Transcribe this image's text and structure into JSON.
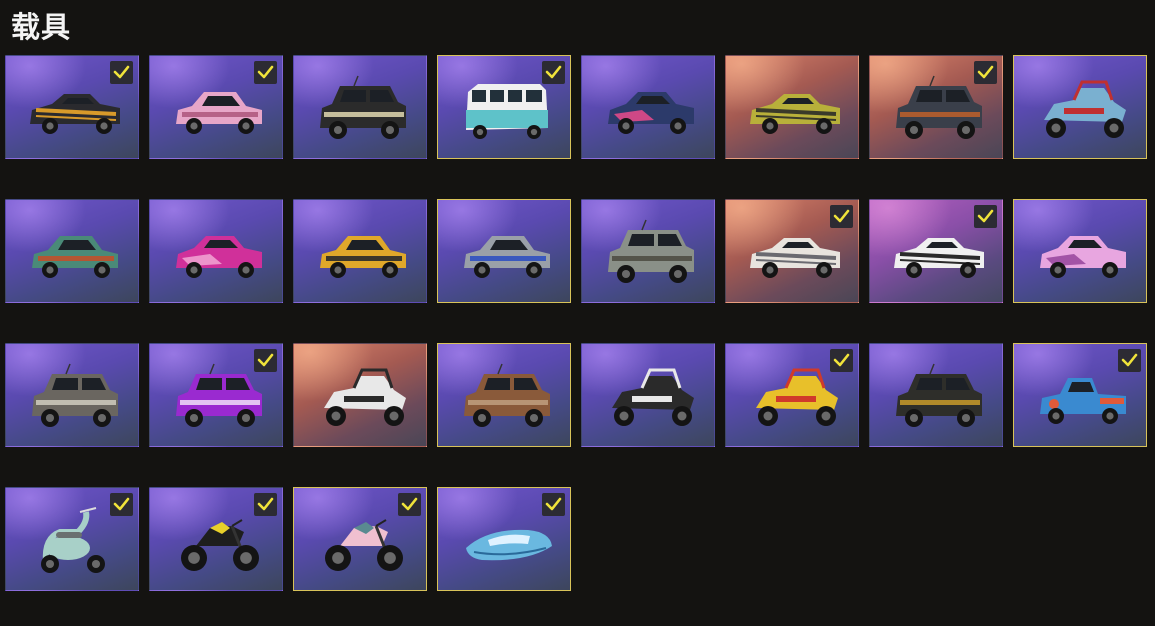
{
  "page": {
    "title": "载具"
  },
  "colors": {
    "accent_gold": "#d8c35a",
    "check_yellow": "#f0e33a",
    "background": "#141311"
  },
  "vehicles": [
    {
      "kind": "muscle-car",
      "bg": "purple",
      "checked": true,
      "gold": false,
      "body": "#2a2a2e",
      "accent": "#d89a2a"
    },
    {
      "kind": "sedan",
      "bg": "purple",
      "checked": true,
      "gold": false,
      "body": "#e7a6c8",
      "accent": "#b05a80"
    },
    {
      "kind": "suv",
      "bg": "purple",
      "checked": false,
      "gold": false,
      "body": "#2b2b2b",
      "accent": "#e0d8b0"
    },
    {
      "kind": "van",
      "bg": "purple",
      "checked": true,
      "gold": true,
      "body": "#f0f0f0",
      "accent": "#5ec2c9"
    },
    {
      "kind": "coupe",
      "bg": "purple",
      "checked": false,
      "gold": false,
      "body": "#2c3a6a",
      "accent": "#e04a8a"
    },
    {
      "kind": "muscle-car",
      "bg": "orange",
      "checked": false,
      "gold": false,
      "body": "#b8b03a",
      "accent": "#3a3a2a"
    },
    {
      "kind": "suv",
      "bg": "orange",
      "checked": true,
      "gold": false,
      "body": "#3a3f4a",
      "accent": "#c0602a"
    },
    {
      "kind": "buggy",
      "bg": "purple",
      "checked": false,
      "gold": true,
      "body": "#7ab0d0",
      "accent": "#c03030"
    },
    {
      "kind": "sedan",
      "bg": "purple",
      "checked": false,
      "gold": false,
      "body": "#4a8a78",
      "accent": "#c0502a"
    },
    {
      "kind": "coupe",
      "bg": "purple",
      "checked": false,
      "gold": false,
      "body": "#d0309a",
      "accent": "#f0a0d0"
    },
    {
      "kind": "sedan",
      "bg": "purple",
      "checked": false,
      "gold": false,
      "body": "#e0a82a",
      "accent": "#2a2a2a"
    },
    {
      "kind": "sedan",
      "bg": "purple",
      "checked": false,
      "gold": true,
      "body": "#9aa0a8",
      "accent": "#3050c0"
    },
    {
      "kind": "suv",
      "bg": "purple",
      "checked": false,
      "gold": false,
      "body": "#8a9088",
      "accent": "#4a4a40"
    },
    {
      "kind": "muscle-car",
      "bg": "orange",
      "checked": true,
      "gold": false,
      "body": "#e8e4de",
      "accent": "#6a6a70"
    },
    {
      "kind": "muscle-car",
      "bg": "pink",
      "checked": true,
      "gold": false,
      "body": "#f0f0f0",
      "accent": "#2a2a2a"
    },
    {
      "kind": "coupe",
      "bg": "purple",
      "checked": false,
      "gold": true,
      "body": "#e8a6e0",
      "accent": "#9a4aa0"
    },
    {
      "kind": "suv",
      "bg": "purple",
      "checked": false,
      "gold": false,
      "body": "#6a6660",
      "accent": "#d0ccc0"
    },
    {
      "kind": "suv",
      "bg": "purple",
      "checked": true,
      "gold": false,
      "body": "#9a2ad0",
      "accent": "#f0e0f8"
    },
    {
      "kind": "buggy",
      "bg": "orange",
      "checked": false,
      "gold": false,
      "body": "#e8e8e8",
      "accent": "#2a2a2a"
    },
    {
      "kind": "suv",
      "bg": "purple",
      "checked": false,
      "gold": true,
      "body": "#8a5a3a",
      "accent": "#c0a080"
    },
    {
      "kind": "buggy",
      "bg": "purple",
      "checked": false,
      "gold": false,
      "body": "#2a2a2a",
      "accent": "#e8e8e8"
    },
    {
      "kind": "buggy",
      "bg": "purple",
      "checked": true,
      "gold": false,
      "body": "#e8c02a",
      "accent": "#d03a2a"
    },
    {
      "kind": "suv",
      "bg": "purple",
      "checked": false,
      "gold": false,
      "body": "#2e2e2a",
      "accent": "#c89a2a"
    },
    {
      "kind": "pickup",
      "bg": "purple",
      "checked": true,
      "gold": true,
      "body": "#3a8ad0",
      "accent": "#e05a3a"
    },
    {
      "kind": "scooter",
      "bg": "purple",
      "checked": true,
      "gold": false,
      "body": "#a8d0c8",
      "accent": "#6a7070"
    },
    {
      "kind": "motorbike",
      "bg": "purple",
      "checked": true,
      "gold": false,
      "body": "#1e1e1e",
      "accent": "#e8d02a"
    },
    {
      "kind": "motorbike",
      "bg": "purple",
      "checked": true,
      "gold": true,
      "body": "#f0c0d0",
      "accent": "#5a8a90"
    },
    {
      "kind": "boat",
      "bg": "purple",
      "checked": true,
      "gold": true,
      "body": "#6ab8e0",
      "accent": "#dff2ff"
    }
  ]
}
